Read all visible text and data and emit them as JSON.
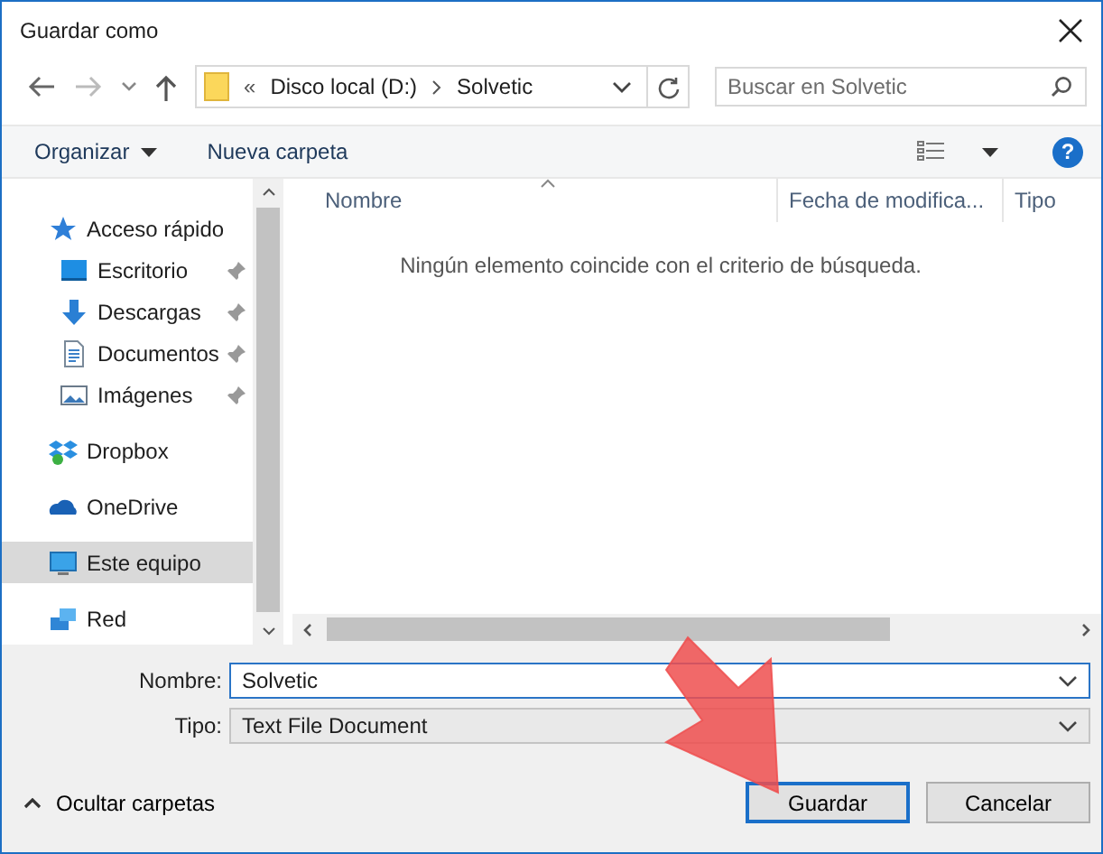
{
  "window": {
    "title": "Guardar como"
  },
  "address": {
    "prefix": "«",
    "path": [
      "Disco local (D:)",
      "Solvetic"
    ]
  },
  "search": {
    "placeholder": "Buscar en Solvetic"
  },
  "toolbar": {
    "organize": "Organizar",
    "new_folder": "Nueva carpeta",
    "help": "?"
  },
  "sidebar": {
    "items": [
      {
        "label": "Acceso rápido",
        "kind": "star",
        "selected": false,
        "children": [
          {
            "label": "Escritorio",
            "kind": "desktop",
            "pinned": true,
            "selected": false
          },
          {
            "label": "Descargas",
            "kind": "download",
            "pinned": true,
            "selected": false
          },
          {
            "label": "Documentos",
            "kind": "document",
            "pinned": true,
            "selected": false
          },
          {
            "label": "Imágenes",
            "kind": "image",
            "pinned": true,
            "selected": false
          }
        ]
      },
      {
        "label": "Dropbox",
        "kind": "dropbox",
        "selected": false
      },
      {
        "label": "OneDrive",
        "kind": "cloud",
        "selected": false
      },
      {
        "label": "Este equipo",
        "kind": "computer",
        "selected": true
      },
      {
        "label": "Red",
        "kind": "network",
        "selected": false
      }
    ]
  },
  "file_list": {
    "columns": [
      "Nombre",
      "Fecha de modifica...",
      "Tipo"
    ],
    "empty_message": "Ningún elemento coincide con el criterio de búsqueda."
  },
  "form": {
    "name_label": "Nombre:",
    "name_value": "Solvetic",
    "type_label": "Tipo:",
    "type_value": "Text File Document"
  },
  "hide_folders": "Ocultar carpetas",
  "buttons": [
    {
      "label": "Guardar",
      "default": true
    },
    {
      "label": "Cancelar",
      "default": false
    }
  ]
}
